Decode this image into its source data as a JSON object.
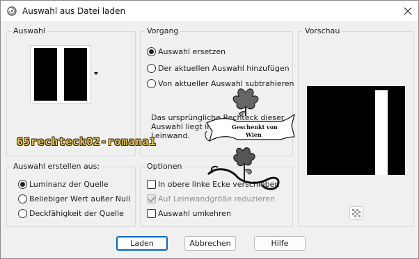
{
  "window": {
    "title": "Auswahl aus Datei laden",
    "icon": "app-swirl-icon",
    "close_icon": "close-icon"
  },
  "auswahl_group": {
    "title": "Auswahl",
    "dropdown_icon": "dropdown-arrow-icon"
  },
  "vorgang_group": {
    "title": "Vorgang",
    "options": [
      {
        "label": "Auswahl ersetzen",
        "selected": true
      },
      {
        "label": "Der aktuellen Auswahl hinzufügen",
        "selected": false
      },
      {
        "label": "Von aktueller Auswahl subtrahieren",
        "selected": false
      }
    ],
    "info_line1": "Das ursprüngliche Rechteck dieser",
    "info_line2": "Auswahl liegt innerhalb der",
    "info_line3": "Leinwand."
  },
  "vorschau_group": {
    "title": "Vorschau",
    "transparency_icon": "checkerboard-icon"
  },
  "erstellen_group": {
    "title": "Auswahl erstellen aus:",
    "options": [
      {
        "label": "Luminanz der Quelle",
        "selected": true
      },
      {
        "label": "Beliebiger Wert außer Null",
        "selected": false
      },
      {
        "label": "Deckfähigkeit der Quelle",
        "selected": false
      }
    ]
  },
  "optionen_group": {
    "title": "Optionen",
    "checks": [
      {
        "label": "In obere linke Ecke verschieben",
        "checked": false,
        "disabled": false
      },
      {
        "label": "Auf Leinwandgröße reduzieren",
        "checked": true,
        "disabled": true
      },
      {
        "label": "Auswahl umkehren",
        "checked": false,
        "disabled": false
      }
    ]
  },
  "buttons": {
    "ok": "Laden",
    "cancel": "Abbrechen",
    "help": "Hilfe"
  },
  "overlay": {
    "watermark": "65rechteck02-romana1",
    "ribbon_line1": "Geschenkt von",
    "ribbon_line2": "Wien"
  }
}
